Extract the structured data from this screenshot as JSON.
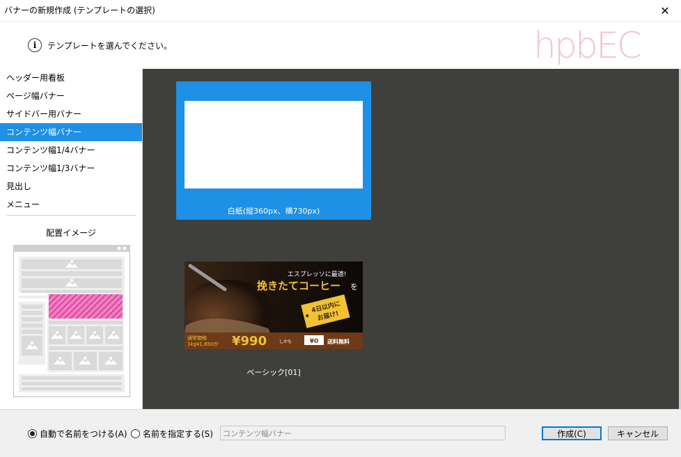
{
  "window": {
    "title": "バナーの新規作成 (テンプレートの選択)",
    "close_glyph": "✕"
  },
  "header": {
    "message": "テンプレートを選んでください。",
    "logo_text": "hpbEC"
  },
  "sidebar": {
    "categories": [
      {
        "label": "ヘッダー用看板"
      },
      {
        "label": "ページ幅バナー"
      },
      {
        "label": "サイドバー用バナー"
      },
      {
        "label": "コンテンツ幅バナー",
        "selected": true
      },
      {
        "label": "コンテンツ幅1/4バナー"
      },
      {
        "label": "コンテンツ幅1/3バナー"
      },
      {
        "label": "見出し"
      },
      {
        "label": "メニュー"
      }
    ],
    "layout_title": "配置イメージ"
  },
  "templates": [
    {
      "label": "白紙(縦360px、横730px)",
      "selected": true
    },
    {
      "label": "ベーシック[01]",
      "banner": {
        "line1": "エスプレッソに最適!",
        "line2": "挽きたてコーヒー",
        "line2_suffix": "を",
        "tag1": "4日以内に",
        "tag2": "お届け!",
        "price_caption1": "通常価格",
        "price_caption2": "1kg¥1,650が",
        "price": "¥990",
        "shikamo": "しかも",
        "shipping_badge": "¥0",
        "shipping": "送料無料"
      }
    }
  ],
  "footer": {
    "radio_auto": "自動で名前をつける(A)",
    "radio_manual": "名前を指定する(S)",
    "name_value": "コンテンツ幅バナー",
    "create_button": "作成(C)",
    "cancel_button": "キャンセル"
  },
  "colors": {
    "accent": "#1e90e6",
    "main_bg": "#3f3f3b",
    "logo_pink": "#f2c4d8",
    "logo_blue": "#c9e3f6"
  }
}
